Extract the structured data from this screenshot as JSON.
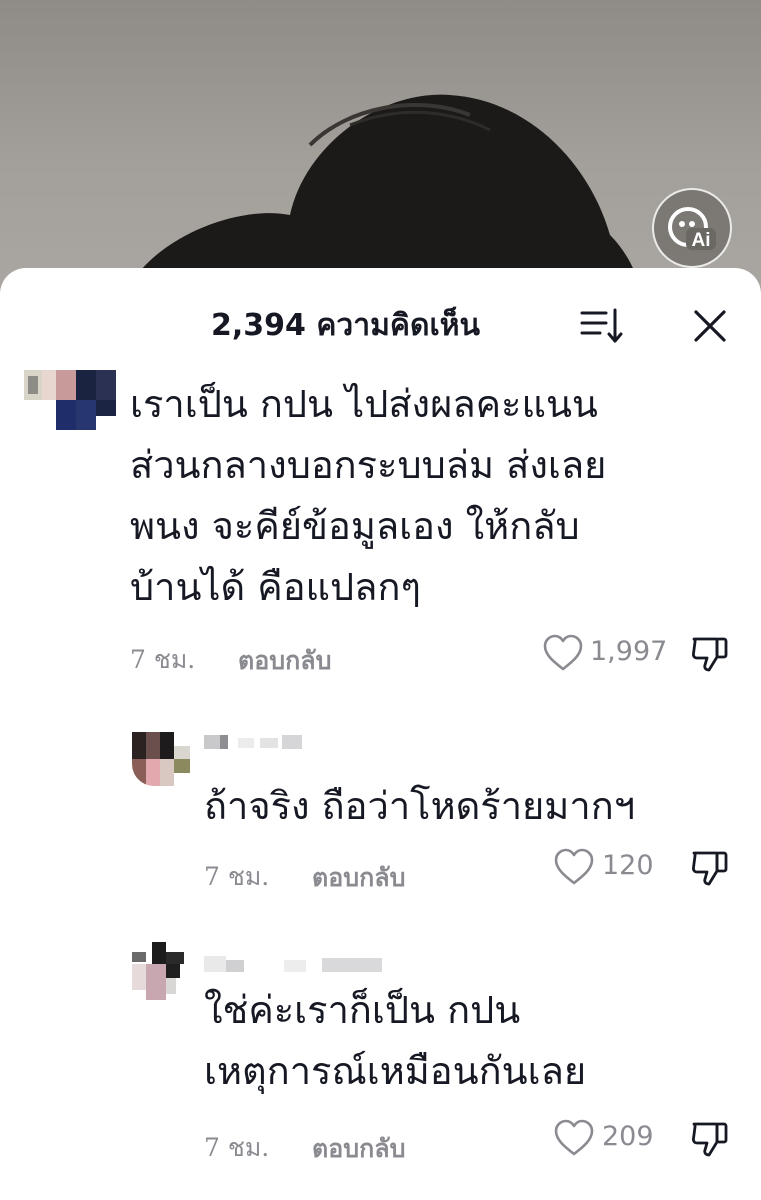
{
  "header": {
    "title": "2,394 ความคิดเห็น"
  },
  "comments": [
    {
      "text": "เราเป็น กปน ไปส่งผลคะแนน\nส่วนกลางบอกระบบล่ม ส่งเลย\nพนง จะคีย์ข้อมูลเอง ให้กลับ\nบ้านได้ คือแปลกๆ",
      "time": "7 ชม.",
      "reply_label": "ตอบกลับ",
      "likes": "1,997"
    },
    {
      "text": "ถ้าจริง ถือว่าโหดร้ายมากฯ",
      "time": "7 ชม.",
      "reply_label": "ตอบกลับ",
      "likes": "120"
    },
    {
      "text": "ใช่ค่ะเราก็เป็น กปน\nเหตุการณ์เหมือนกันเลย",
      "time": "7 ชม.",
      "reply_label": "ตอบกลับ",
      "likes": "209"
    }
  ],
  "icons": {
    "ai_badge": "ai-badge-icon",
    "sort": "sort-icon",
    "close": "close-icon",
    "like": "heart-outline-icon",
    "dislike": "thumbs-down-outline-icon"
  },
  "colors": {
    "text_primary": "#161823",
    "text_secondary": "#8a8b91",
    "sheet_bg": "#ffffff"
  }
}
